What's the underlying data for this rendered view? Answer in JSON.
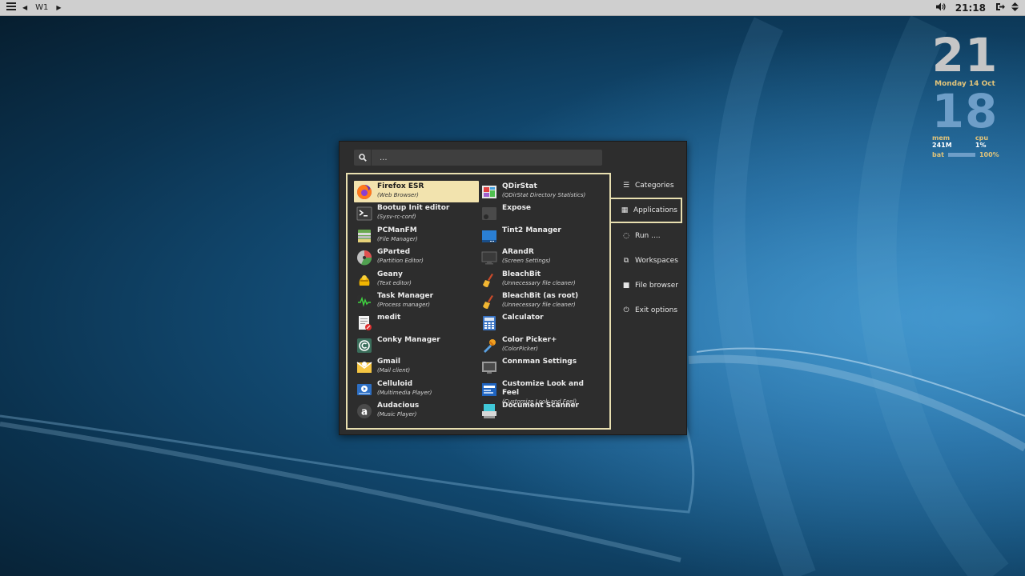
{
  "panel": {
    "workspace": "W1",
    "clock": "21:18"
  },
  "conky": {
    "hour": "21",
    "date": "Monday 14 Oct",
    "minute": "18",
    "mem_label": "mem",
    "mem_value": "241M",
    "cpu_label": "cpu",
    "cpu_value": "1%",
    "bat_label": "bat",
    "bat_value": "100%",
    "bat_level": 1.0
  },
  "menu": {
    "search_placeholder": "...",
    "apps": [
      {
        "name": "Firefox ESR",
        "desc": "(Web Browser)",
        "icon": "firefox-icon",
        "selected": true
      },
      {
        "name": "QDirStat",
        "desc": "(QDirStat Directory Statistics)",
        "icon": "qdirstat-icon"
      },
      {
        "name": "Bootup Init editor",
        "desc": "(Sysv-rc-conf)",
        "icon": "terminal-icon"
      },
      {
        "name": "Expose",
        "desc": "",
        "icon": "expose-icon"
      },
      {
        "name": "PCManFM",
        "desc": "(File Manager)",
        "icon": "file-manager-icon"
      },
      {
        "name": "Tint2 Manager",
        "desc": "",
        "icon": "tint2-icon"
      },
      {
        "name": "GParted",
        "desc": "(Partition Editor)",
        "icon": "gparted-icon"
      },
      {
        "name": "ARandR",
        "desc": "(Screen Settings)",
        "icon": "monitor-icon"
      },
      {
        "name": "Geany",
        "desc": "(Text editor)",
        "icon": "geany-icon"
      },
      {
        "name": "BleachBit",
        "desc": "(Unnecessary file cleaner)",
        "icon": "broom-icon"
      },
      {
        "name": "Task Manager",
        "desc": "(Process manager)",
        "icon": "task-manager-icon"
      },
      {
        "name": "BleachBit (as root)",
        "desc": "(Unnecessary file cleaner)",
        "icon": "broom-icon"
      },
      {
        "name": "medit",
        "desc": "",
        "icon": "medit-icon"
      },
      {
        "name": "Calculator",
        "desc": "",
        "icon": "calculator-icon"
      },
      {
        "name": "Conky Manager",
        "desc": "",
        "icon": "conky-icon"
      },
      {
        "name": "Color Picker+",
        "desc": "(ColorPicker)",
        "icon": "color-picker-icon"
      },
      {
        "name": "Gmail",
        "desc": "(Mail client)",
        "icon": "mail-icon"
      },
      {
        "name": "Connman Settings",
        "desc": "",
        "icon": "network-icon"
      },
      {
        "name": "Celluloid",
        "desc": "(Multimedia Player)",
        "icon": "video-player-icon"
      },
      {
        "name": "Customize Look and Feel",
        "desc": "(Customize Look and Feel)",
        "icon": "appearance-icon"
      },
      {
        "name": "Audacious",
        "desc": "(Music Player)",
        "icon": "audacious-icon"
      },
      {
        "name": "Document Scanner",
        "desc": "",
        "icon": "scanner-icon"
      }
    ],
    "side": [
      {
        "label": "Categories",
        "icon": "list-icon",
        "glyph": "☰"
      },
      {
        "label": "Applications",
        "icon": "grid-icon",
        "glyph": "▦",
        "active": true
      },
      {
        "label": "Run ....",
        "icon": "spinner-icon",
        "glyph": "◌"
      },
      {
        "label": "Workspaces",
        "icon": "workspaces-icon",
        "glyph": "⧉"
      },
      {
        "label": "File browser",
        "icon": "folder-icon",
        "glyph": "■"
      },
      {
        "label": "Exit options",
        "icon": "power-icon",
        "glyph": "⏻"
      }
    ]
  }
}
